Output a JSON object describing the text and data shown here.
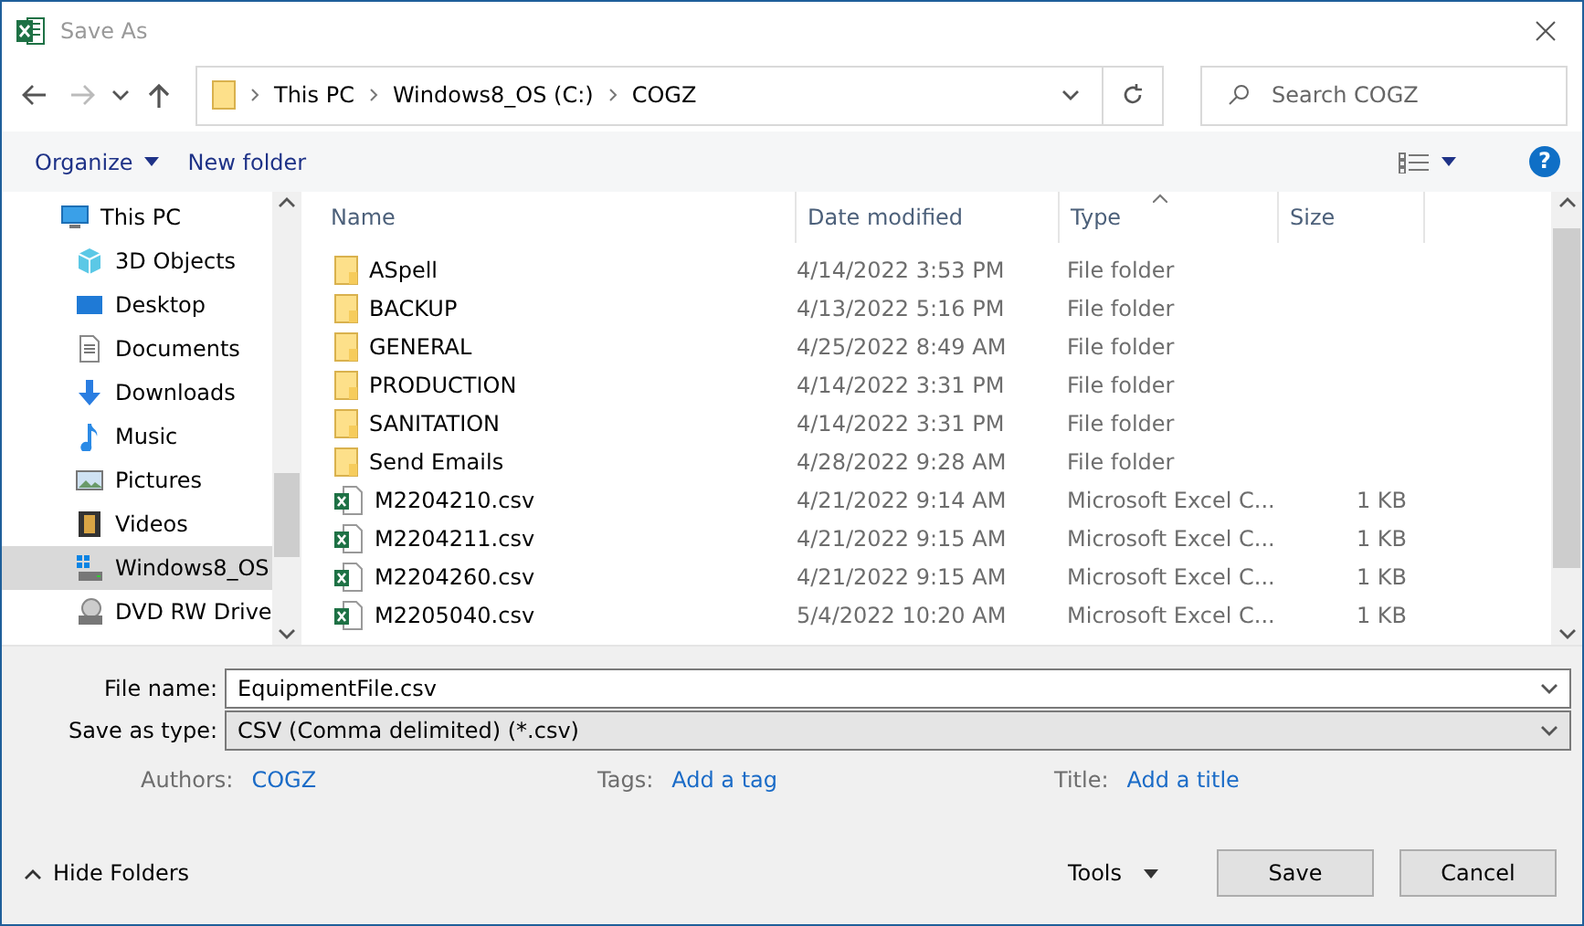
{
  "window": {
    "title": "Save As"
  },
  "address": {
    "path": [
      "This PC",
      "Windows8_OS (C:)",
      "COGZ"
    ]
  },
  "search": {
    "placeholder": "Search COGZ"
  },
  "toolbar": {
    "organize": "Organize",
    "new_folder": "New folder",
    "help": "?"
  },
  "sidebar": {
    "items": [
      {
        "label": "This PC",
        "kind": "pc",
        "selected": false
      },
      {
        "label": "3D Objects",
        "kind": "cube",
        "selected": false
      },
      {
        "label": "Desktop",
        "kind": "desktop",
        "selected": false
      },
      {
        "label": "Documents",
        "kind": "document",
        "selected": false
      },
      {
        "label": "Downloads",
        "kind": "download",
        "selected": false
      },
      {
        "label": "Music",
        "kind": "music",
        "selected": false
      },
      {
        "label": "Pictures",
        "kind": "picture",
        "selected": false
      },
      {
        "label": "Videos",
        "kind": "video",
        "selected": false
      },
      {
        "label": "Windows8_OS",
        "kind": "drive",
        "selected": true
      },
      {
        "label": "DVD RW Drive",
        "kind": "dvd",
        "selected": false
      }
    ]
  },
  "table": {
    "columns": [
      "Name",
      "Date modified",
      "Type",
      "Size"
    ],
    "rows": [
      {
        "kind": "folder",
        "name": "ASpell",
        "date": "4/14/2022 3:53 PM",
        "type": "File folder"
      },
      {
        "kind": "folder",
        "name": "BACKUP",
        "date": "4/13/2022 5:16 PM",
        "type": "File folder"
      },
      {
        "kind": "folder",
        "name": "GENERAL",
        "date": "4/25/2022 8:49 AM",
        "type": "File folder"
      },
      {
        "kind": "folder",
        "name": "PRODUCTION",
        "date": "4/14/2022 3:31 PM",
        "type": "File folder"
      },
      {
        "kind": "folder",
        "name": "SANITATION",
        "date": "4/14/2022 3:31 PM",
        "type": "File folder"
      },
      {
        "kind": "folder",
        "name": "Send Emails",
        "date": "4/28/2022 9:28 AM",
        "type": "File folder"
      },
      {
        "kind": "csv",
        "name": "M2204210.csv",
        "date": "4/21/2022 9:14 AM",
        "type": "Microsoft Excel C...",
        "size": "1 KB"
      },
      {
        "kind": "csv",
        "name": "M2204211.csv",
        "date": "4/21/2022 9:15 AM",
        "type": "Microsoft Excel C...",
        "size": "1 KB"
      },
      {
        "kind": "csv",
        "name": "M2204260.csv",
        "date": "4/21/2022 9:15 AM",
        "type": "Microsoft Excel C...",
        "size": "1 KB"
      },
      {
        "kind": "csv",
        "name": "M2205040.csv",
        "date": "5/4/2022 10:20 AM",
        "type": "Microsoft Excel C...",
        "size": "1 KB"
      }
    ]
  },
  "form": {
    "file_name_label": "File name:",
    "file_name": "EquipmentFile.csv",
    "type_label": "Save as type:",
    "type_value": "CSV (Comma delimited) (*.csv)"
  },
  "meta": [
    {
      "label": "Authors:",
      "value": "COGZ"
    },
    {
      "label": "Tags:",
      "value": "Add a tag"
    },
    {
      "label": "Title:",
      "value": "Add a title"
    }
  ],
  "footer": {
    "hide_folders": "Hide Folders",
    "tools": "Tools",
    "save": "Save",
    "cancel": "Cancel"
  }
}
